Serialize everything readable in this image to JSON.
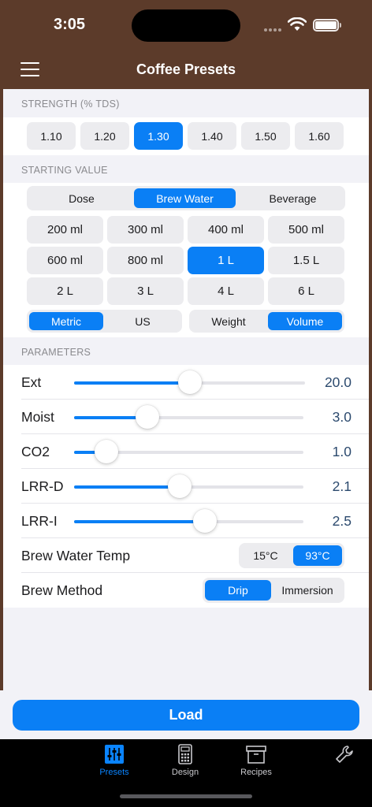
{
  "status": {
    "time": "3:05"
  },
  "nav": {
    "title": "Coffee Presets"
  },
  "strength": {
    "header": "STRENGTH (% TDS)",
    "options": [
      "1.10",
      "1.20",
      "1.30",
      "1.40",
      "1.50",
      "1.60"
    ],
    "selected": "1.30"
  },
  "starting": {
    "header": "STARTING VALUE",
    "type_options": [
      "Dose",
      "Brew Water",
      "Beverage"
    ],
    "type_selected": "Brew Water",
    "volumes": [
      "200 ml",
      "300 ml",
      "400 ml",
      "500 ml",
      "600 ml",
      "800 ml",
      "1 L",
      "1.5 L",
      "2 L",
      "3 L",
      "4 L",
      "6 L"
    ],
    "volume_selected": "1 L",
    "units": [
      "Metric",
      "US"
    ],
    "unit_selected": "Metric",
    "measure": [
      "Weight",
      "Volume"
    ],
    "measure_selected": "Volume"
  },
  "parameters": {
    "header": "PARAMETERS",
    "sliders": [
      {
        "label": "Ext",
        "value": "20.0",
        "fraction": 0.5
      },
      {
        "label": "Moist",
        "value": "3.0",
        "fraction": 0.32
      },
      {
        "label": "CO2",
        "value": "1.0",
        "fraction": 0.14
      },
      {
        "label": "LRR-D",
        "value": "2.1",
        "fraction": 0.46
      },
      {
        "label": "LRR-I",
        "value": "2.5",
        "fraction": 0.57
      }
    ],
    "temp": {
      "label": "Brew Water Temp",
      "options": [
        "15°C",
        "93°C"
      ],
      "selected": "93°C"
    },
    "method": {
      "label": "Brew Method",
      "options": [
        "Drip",
        "Immersion"
      ],
      "selected": "Drip"
    }
  },
  "load": {
    "label": "Load"
  },
  "tabs": [
    {
      "label": "Presets",
      "icon": "sliders-icon",
      "selected": true
    },
    {
      "label": "Design",
      "icon": "calculator-icon",
      "selected": false
    },
    {
      "label": "Recipes",
      "icon": "archive-box-icon",
      "selected": false
    },
    {
      "label": "",
      "icon": "wrench-icon",
      "selected": false
    }
  ],
  "colors": {
    "accent": "#0a7ff5",
    "brand_brown": "#5c3b2a",
    "sheet": "#f2f2f7"
  }
}
